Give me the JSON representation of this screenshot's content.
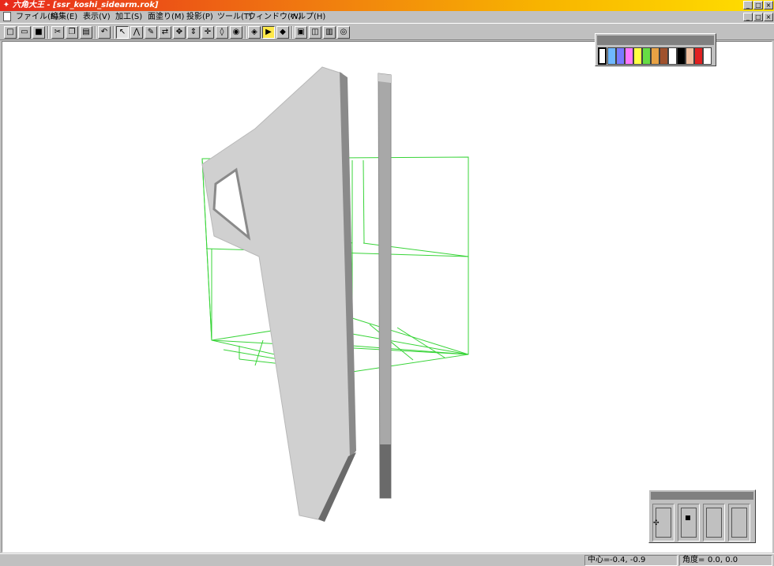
{
  "window": {
    "title": "六角大王 - [ssr_koshi_sidearm.rok]",
    "app_icon": "app-logo-icon",
    "caption_buttons": [
      "minimize",
      "restore",
      "close"
    ]
  },
  "menu": {
    "items": [
      {
        "label": "ファイル(F)"
      },
      {
        "label": "編集(E)"
      },
      {
        "label": "表示(V)"
      },
      {
        "label": "加工(S)"
      },
      {
        "label": "面塗り(M)"
      },
      {
        "label": "投影(P)"
      },
      {
        "label": "ツール(T)"
      },
      {
        "label": "ウィンドウ(W)"
      },
      {
        "label": "ヘルプ(H)"
      }
    ]
  },
  "toolbar": {
    "buttons": [
      {
        "icon": "new-file-icon",
        "glyph": "□"
      },
      {
        "icon": "open-folder-icon",
        "glyph": "▭"
      },
      {
        "icon": "save-disk-icon",
        "glyph": "■"
      },
      {
        "icon": "cut-icon",
        "glyph": "✂"
      },
      {
        "icon": "copy-icon",
        "glyph": "❐"
      },
      {
        "icon": "paste-icon",
        "glyph": "▤"
      },
      {
        "icon": "undo-icon",
        "glyph": "↶"
      },
      {
        "icon": "select-arrow-icon",
        "glyph": "↖"
      },
      {
        "icon": "polyline-icon",
        "glyph": "⋀"
      },
      {
        "icon": "brush-icon",
        "glyph": "✎"
      },
      {
        "icon": "rotate-icon",
        "glyph": "⇄"
      },
      {
        "icon": "magic-icon",
        "glyph": "✥"
      },
      {
        "icon": "scale-icon",
        "glyph": "⇕"
      },
      {
        "icon": "move-icon",
        "glyph": "✛"
      },
      {
        "icon": "drop-icon",
        "glyph": "◊"
      },
      {
        "icon": "eye-icon",
        "glyph": "◉"
      },
      {
        "icon": "perspective-icon",
        "glyph": "◈"
      },
      {
        "icon": "light-icon",
        "glyph": "▶"
      },
      {
        "icon": "shade-icon",
        "glyph": "◆"
      },
      {
        "icon": "render-icon",
        "glyph": "▣"
      },
      {
        "icon": "cube-icon",
        "glyph": "◫"
      },
      {
        "icon": "split-view-icon",
        "glyph": "▥"
      },
      {
        "icon": "camera-icon",
        "glyph": "◎"
      }
    ]
  },
  "palette": {
    "colors": [
      "#ffffff",
      "#6fb8ff",
      "#7a7aff",
      "#ff77ff",
      "#ffff44",
      "#66dd44",
      "#e8a244",
      "#a0522d",
      "#ffffff",
      "#000000",
      "#f0c0a0",
      "#e02020",
      "#ffffff"
    ],
    "selected_index": 0
  },
  "navigator": {
    "active_cell": 1
  },
  "status": {
    "center_label": "中心=",
    "center_value": "-0.4, -0.9",
    "angle_label": "角度=",
    "angle_value": "0.0,  0.0"
  },
  "colors": {
    "wireframe": "#38d438",
    "model_face": "#d0d0d0",
    "model_side": "#8a8a8a",
    "model_dark": "#6a6a6a"
  }
}
